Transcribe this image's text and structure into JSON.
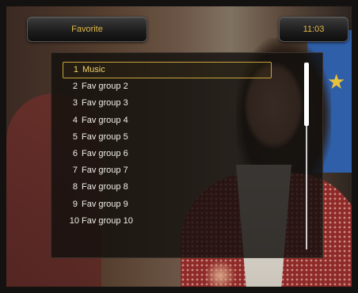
{
  "header": {
    "title": "Favorite",
    "time": "11:03"
  },
  "list": {
    "selected_index": 0,
    "items": [
      {
        "num": "1",
        "label": "Music"
      },
      {
        "num": "2",
        "label": "Fav group 2"
      },
      {
        "num": "3",
        "label": "Fav group 3"
      },
      {
        "num": "4",
        "label": "Fav group 4"
      },
      {
        "num": "5",
        "label": "Fav group 5"
      },
      {
        "num": "6",
        "label": "Fav group 6"
      },
      {
        "num": "7",
        "label": "Fav group 7"
      },
      {
        "num": "8",
        "label": "Fav group 8"
      },
      {
        "num": "9",
        "label": "Fav group 9"
      },
      {
        "num": "10",
        "label": "Fav group 10"
      }
    ]
  },
  "colors": {
    "accent": "#e0b84a",
    "selection_border": "#c9a43a",
    "text": "#f0efe9"
  }
}
